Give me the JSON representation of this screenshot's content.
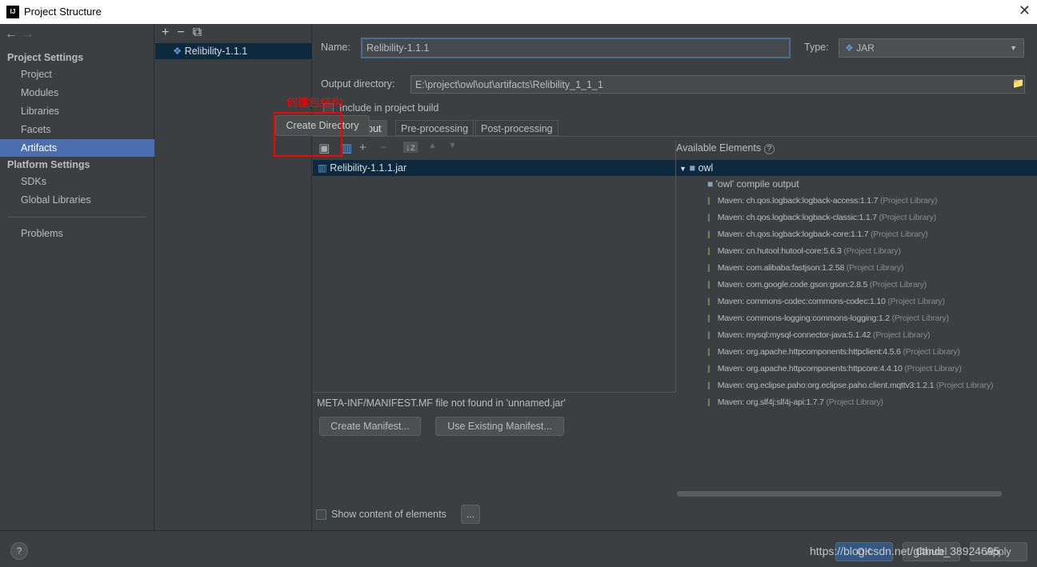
{
  "window": {
    "title": "Project Structure",
    "logo": "IJ"
  },
  "sidebar": {
    "project_settings": "Project Settings",
    "project_items": [
      {
        "label": "Project"
      },
      {
        "label": "Modules"
      },
      {
        "label": "Libraries"
      },
      {
        "label": "Facets"
      },
      {
        "label": "Artifacts",
        "selected": true
      }
    ],
    "platform_settings": "Platform Settings",
    "platform_items": [
      {
        "label": "SDKs"
      },
      {
        "label": "Global Libraries"
      }
    ],
    "problems": "Problems"
  },
  "artifacts": {
    "items": [
      {
        "label": "Relibility-1.1.1"
      }
    ]
  },
  "form": {
    "name_label": "Name:",
    "name_value": "Relibility-1.1.1",
    "type_label": "Type:",
    "type_value": "JAR",
    "output_label": "Output directory:",
    "output_value": "E:\\project\\owl\\out\\artifacts\\Relibility_1_1_1",
    "include_label": "Include in project build",
    "include_checked": false,
    "tabs": [
      "Output Layout",
      "Pre-processing",
      "Post-processing"
    ],
    "tree_root": "Relibility-1.1.1.jar",
    "manifest_msg": "META-INF/MANIFEST.MF file not found in 'unnamed.jar'",
    "create_manifest": "Create Manifest...",
    "use_manifest": "Use Existing Manifest...",
    "show_content": "Show content of elements",
    "more": "..."
  },
  "available": {
    "title": "Available Elements",
    "root": "owl",
    "compile_output": "'owl' compile output",
    "items": [
      {
        "name": "Maven: ch.qos.logback:logback-access:1.1.7",
        "tag": "(Project Library)"
      },
      {
        "name": "Maven: ch.qos.logback:logback-classic:1.1.7",
        "tag": "(Project Library)"
      },
      {
        "name": "Maven: ch.qos.logback:logback-core:1.1.7",
        "tag": "(Project Library)"
      },
      {
        "name": "Maven: cn.hutool:hutool-core:5.6.3",
        "tag": "(Project Library)"
      },
      {
        "name": "Maven: com.alibaba:fastjson:1.2.58",
        "tag": "(Project Library)"
      },
      {
        "name": "Maven: com.google.code.gson:gson:2.8.5",
        "tag": "(Project Library)"
      },
      {
        "name": "Maven: commons-codec:commons-codec:1.10",
        "tag": "(Project Library)"
      },
      {
        "name": "Maven: commons-logging:commons-logging:1.2",
        "tag": "(Project Library)"
      },
      {
        "name": "Maven: mysql:mysql-connector-java:5.1.42",
        "tag": "(Project Library)"
      },
      {
        "name": "Maven: org.apache.httpcomponents:httpclient:4.5.6",
        "tag": "(Project Library)"
      },
      {
        "name": "Maven: org.apache.httpcomponents:httpcore:4.4.10",
        "tag": "(Project Library)"
      },
      {
        "name": "Maven: org.eclipse.paho:org.eclipse.paho.client.mqttv3:1.2.1",
        "tag": "(Project Library)"
      },
      {
        "name": "Maven: org.slf4j:slf4j-api:1.7.7",
        "tag": "(Project Library)"
      }
    ]
  },
  "tooltip": "Create Directory",
  "annotation": "创建包结构",
  "footer": {
    "ok": "OK",
    "cancel": "Cancel",
    "apply": "Apply",
    "help": "?"
  },
  "watermark": "https://blog.csdn.net/github_38924695",
  "colors": {
    "selection": "#4b6eaf",
    "ok": "#365880",
    "annotation": "#ff0000"
  }
}
